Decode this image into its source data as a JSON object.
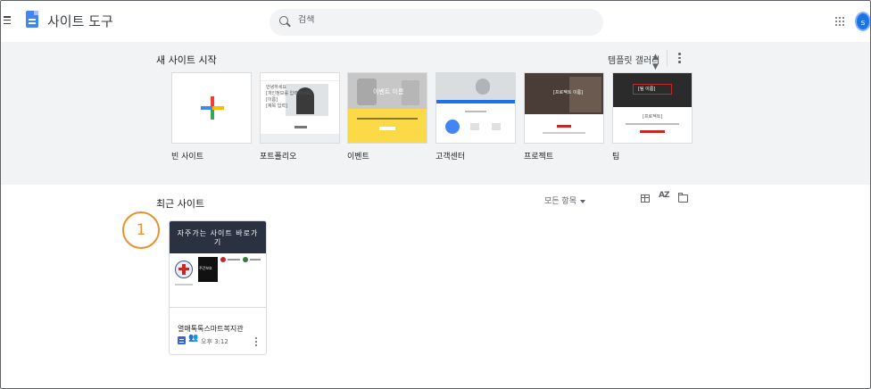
{
  "header": {
    "app_title": "사이트 도구",
    "search_placeholder": "검색",
    "avatar_letter": "s"
  },
  "templates": {
    "title": "새 사이트 시작",
    "gallery_label": "템플릿 갤러리",
    "items": [
      {
        "label": "빈 사이트"
      },
      {
        "label": "포트폴리오",
        "thumb_text": [
          "안녕하세요",
          "[개인정보를 입력하세요]",
          "[이름]",
          "[제목 입력]"
        ]
      },
      {
        "label": "이벤트",
        "thumb_text": [
          "이벤트 이름"
        ]
      },
      {
        "label": "고객센터"
      },
      {
        "label": "프로젝트",
        "thumb_text": [
          "[프로젝트 이름]"
        ]
      },
      {
        "label": "팀",
        "thumb_text": [
          "[팀 이름]",
          "[프로젝트]"
        ]
      }
    ]
  },
  "recent": {
    "title": "최근 사이트",
    "owner_filter": "모든 항목",
    "sort_icon_text": "AZ",
    "callout_number": "1",
    "sites": [
      {
        "hero_text": "자주가는 사이트 바로가기",
        "thumb_caption": "주간보호",
        "name": "열매톡톡스마트복지관",
        "modified": "오후 3:12"
      }
    ]
  },
  "colors": {
    "accent": "#1a73e8",
    "callout": "#e8912f",
    "template_bg": "#f1f3f4",
    "event_yellow": "#fcd947"
  }
}
